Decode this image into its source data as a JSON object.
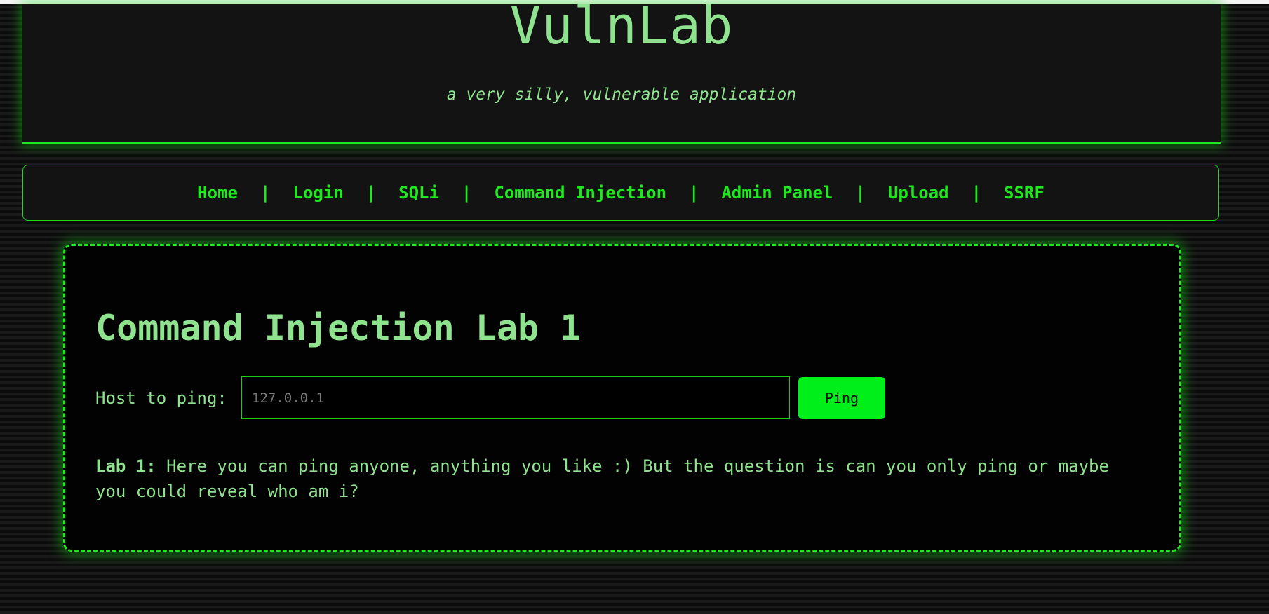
{
  "header": {
    "title": "VulnLab",
    "tagline": "a very silly, vulnerable application"
  },
  "nav": {
    "items": [
      {
        "label": "Home"
      },
      {
        "label": "Login"
      },
      {
        "label": "SQLi"
      },
      {
        "label": "Command Injection"
      },
      {
        "label": "Admin Panel"
      },
      {
        "label": "Upload"
      },
      {
        "label": "SSRF"
      }
    ],
    "separator": "|"
  },
  "lab": {
    "title": "Command Injection Lab 1",
    "host_label": "Host to ping:",
    "host_placeholder": "127.0.0.1",
    "host_value": "",
    "ping_button": "Ping",
    "desc_tag": "Lab 1:",
    "desc_text": "Here you can ping anyone, anything you like :) But the question is can you only ping or maybe you could reveal who am i?"
  },
  "colors": {
    "accent": "#1ee81e",
    "text": "#8fe38f",
    "button": "#00ee1a",
    "background": "#121212"
  }
}
